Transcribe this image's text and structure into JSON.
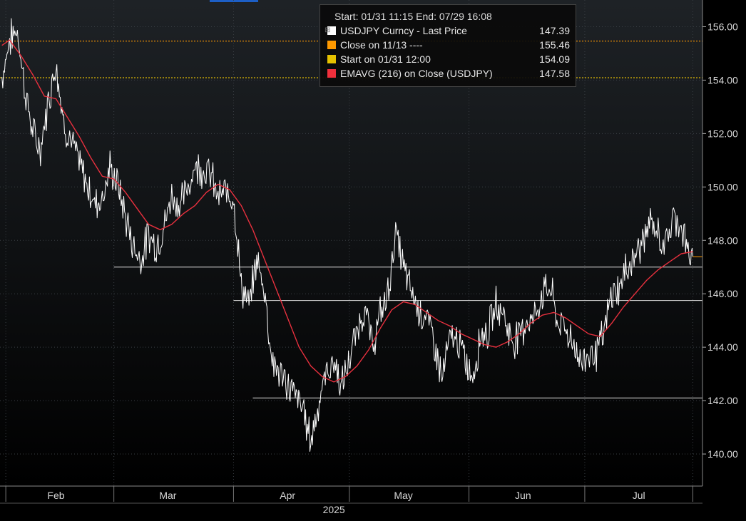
{
  "colors": {
    "background_top": "#1e2226",
    "background_bottom": "#000000",
    "grid": "#3a3f44",
    "price": "#ffffff",
    "ema": "#e8303e",
    "close_line": "#ff9a00",
    "start_line": "#ffd400",
    "axis_text": "#d8d8d8",
    "support": "#e6e6e6",
    "top_tab": "#1d5fc6"
  },
  "legend": {
    "title": "Start: 01/31 11:15 End: 07/29 16:08",
    "items": [
      {
        "label": "USDJPY Curncy - Last Price",
        "value": "147.39",
        "color": "#ffffff"
      },
      {
        "label": "Close on 11/13 ----",
        "value": "155.46",
        "color": "#ff9a00"
      },
      {
        "label": "Start on 01/31 12:00",
        "value": "154.09",
        "color": "#e6c200"
      },
      {
        "label": "EMAVG (216)  on Close (USDJPY)",
        "value": "147.58",
        "color": "#f0303c"
      }
    ]
  },
  "chart_data": {
    "type": "line",
    "y_range": [
      138.8,
      157
    ],
    "y_ticks": [
      140,
      142,
      144,
      146,
      148,
      150,
      152,
      154,
      156
    ],
    "y_tick_labels": [
      "140.00",
      "142.00",
      "144.00",
      "146.00",
      "148.00",
      "150.00",
      "152.00",
      "154.00",
      "156.00"
    ],
    "x_range": [
      "2025-01-31",
      "2025-08-01"
    ],
    "x_month_boundaries": [
      "2025-02-01",
      "2025-03-01",
      "2025-04-01",
      "2025-05-01",
      "2025-06-01",
      "2025-07-01",
      "2025-07-29"
    ],
    "x_month_labels": [
      {
        "label": "Feb",
        "date": "2025-02-14"
      },
      {
        "label": "Mar",
        "date": "2025-03-15"
      },
      {
        "label": "Apr",
        "date": "2025-04-15"
      },
      {
        "label": "May",
        "date": "2025-05-15"
      },
      {
        "label": "Jun",
        "date": "2025-06-15"
      },
      {
        "label": "Jul",
        "date": "2025-07-15"
      }
    ],
    "year_label": "2025",
    "series": [
      {
        "name": "USDJPY Curncy - Last Price",
        "x": [
          "2025-01-31",
          "2025-02-02",
          "2025-02-04",
          "2025-02-06",
          "2025-02-08",
          "2025-02-10",
          "2025-02-12",
          "2025-02-14",
          "2025-02-16",
          "2025-02-18",
          "2025-02-20",
          "2025-02-22",
          "2025-02-24",
          "2025-02-26",
          "2025-02-28",
          "2025-03-02",
          "2025-03-04",
          "2025-03-06",
          "2025-03-08",
          "2025-03-10",
          "2025-03-12",
          "2025-03-14",
          "2025-03-16",
          "2025-03-18",
          "2025-03-20",
          "2025-03-22",
          "2025-03-24",
          "2025-03-26",
          "2025-03-28",
          "2025-03-30",
          "2025-04-01",
          "2025-04-03",
          "2025-04-05",
          "2025-04-07",
          "2025-04-09",
          "2025-04-11",
          "2025-04-13",
          "2025-04-15",
          "2025-04-17",
          "2025-04-19",
          "2025-04-21",
          "2025-04-23",
          "2025-04-25",
          "2025-04-27",
          "2025-04-29",
          "2025-05-01",
          "2025-05-03",
          "2025-05-05",
          "2025-05-07",
          "2025-05-09",
          "2025-05-11",
          "2025-05-13",
          "2025-05-15",
          "2025-05-17",
          "2025-05-19",
          "2025-05-21",
          "2025-05-23",
          "2025-05-25",
          "2025-05-27",
          "2025-05-29",
          "2025-05-31",
          "2025-06-02",
          "2025-06-04",
          "2025-06-06",
          "2025-06-08",
          "2025-06-10",
          "2025-06-12",
          "2025-06-14",
          "2025-06-16",
          "2025-06-18",
          "2025-06-20",
          "2025-06-22",
          "2025-06-24",
          "2025-06-26",
          "2025-06-28",
          "2025-06-30",
          "2025-07-02",
          "2025-07-04",
          "2025-07-06",
          "2025-07-08",
          "2025-07-10",
          "2025-07-12",
          "2025-07-14",
          "2025-07-16",
          "2025-07-18",
          "2025-07-20",
          "2025-07-22",
          "2025-07-24",
          "2025-07-26",
          "2025-07-28",
          "2025-07-29"
        ],
        "y": [
          154.1,
          155.5,
          155.9,
          153.6,
          152.0,
          151.4,
          153.2,
          154.7,
          152.4,
          151.7,
          150.9,
          150.1,
          149.4,
          149.6,
          150.7,
          150.1,
          148.9,
          147.8,
          147.3,
          148.2,
          147.8,
          148.5,
          149.7,
          149.3,
          149.9,
          150.8,
          150.7,
          150.5,
          149.6,
          149.8,
          149.7,
          146.3,
          145.5,
          147.3,
          146.2,
          143.5,
          143.0,
          142.6,
          142.2,
          141.7,
          140.5,
          141.9,
          143.0,
          143.5,
          142.5,
          143.5,
          144.6,
          145.5,
          144.0,
          145.2,
          146.0,
          148.3,
          147.0,
          146.1,
          145.4,
          145.1,
          144.2,
          142.8,
          144.3,
          144.3,
          143.5,
          142.9,
          144.5,
          144.6,
          145.6,
          145.3,
          144.2,
          144.5,
          145.0,
          145.1,
          146.0,
          146.3,
          144.9,
          144.7,
          144.2,
          143.4,
          143.8,
          143.8,
          144.5,
          146.0,
          146.2,
          147.0,
          147.4,
          148.0,
          148.6,
          148.2,
          147.8,
          148.9,
          148.6,
          147.4,
          147.39
        ]
      },
      {
        "name": "EMAVG (216)  on Close (USDJPY)",
        "x": [
          "2025-01-31",
          "2025-02-02",
          "2025-02-05",
          "2025-02-08",
          "2025-02-11",
          "2025-02-14",
          "2025-02-17",
          "2025-02-20",
          "2025-02-23",
          "2025-02-26",
          "2025-03-01",
          "2025-03-04",
          "2025-03-07",
          "2025-03-10",
          "2025-03-13",
          "2025-03-16",
          "2025-03-19",
          "2025-03-22",
          "2025-03-25",
          "2025-03-28",
          "2025-03-31",
          "2025-04-03",
          "2025-04-06",
          "2025-04-09",
          "2025-04-12",
          "2025-04-15",
          "2025-04-18",
          "2025-04-21",
          "2025-04-24",
          "2025-04-27",
          "2025-04-30",
          "2025-05-03",
          "2025-05-06",
          "2025-05-09",
          "2025-05-12",
          "2025-05-15",
          "2025-05-18",
          "2025-05-21",
          "2025-05-24",
          "2025-05-27",
          "2025-05-30",
          "2025-06-02",
          "2025-06-05",
          "2025-06-08",
          "2025-06-11",
          "2025-06-14",
          "2025-06-17",
          "2025-06-20",
          "2025-06-23",
          "2025-06-26",
          "2025-06-29",
          "2025-07-02",
          "2025-07-05",
          "2025-07-08",
          "2025-07-11",
          "2025-07-14",
          "2025-07-17",
          "2025-07-20",
          "2025-07-23",
          "2025-07-26",
          "2025-07-29"
        ],
        "y": [
          155.3,
          155.5,
          154.9,
          154.2,
          153.4,
          153.3,
          152.6,
          151.9,
          151.1,
          150.4,
          150.3,
          149.8,
          149.2,
          148.6,
          148.4,
          148.6,
          149.0,
          149.3,
          149.8,
          150.1,
          149.9,
          149.3,
          148.4,
          147.3,
          146.2,
          145.1,
          144.0,
          143.3,
          142.9,
          142.7,
          142.9,
          143.3,
          143.9,
          144.7,
          145.4,
          145.7,
          145.6,
          145.3,
          145.0,
          144.8,
          144.5,
          144.3,
          144.1,
          144.0,
          144.2,
          144.5,
          144.9,
          145.2,
          145.3,
          145.1,
          144.8,
          144.5,
          144.4,
          144.9,
          145.5,
          146.0,
          146.5,
          146.9,
          147.2,
          147.5,
          147.58
        ]
      }
    ],
    "reference_lines": [
      {
        "name": "Close on 11/13",
        "value": 155.46
      },
      {
        "name": "Start on 01/31 12:00",
        "value": 154.09
      }
    ],
    "support_lines": [
      {
        "from": "2025-03-01",
        "value": 147.0
      },
      {
        "from": "2025-04-01",
        "value": 145.75
      },
      {
        "from": "2025-04-06",
        "value": 142.1
      }
    ],
    "last_price": 147.39,
    "ema_last": 147.58
  }
}
